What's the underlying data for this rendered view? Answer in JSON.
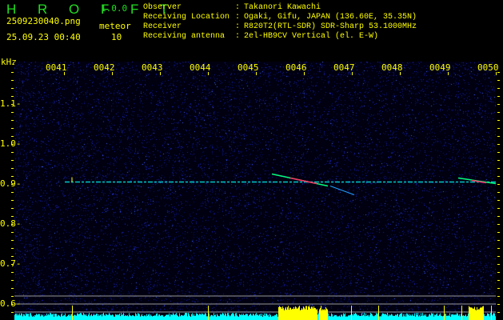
{
  "app": {
    "name": "H R O F F T",
    "version": "1.0.0"
  },
  "file": {
    "name": "2509230040.png",
    "datetime": "25.09.23 00:40"
  },
  "meteor": {
    "label": "meteor",
    "count": "10"
  },
  "info": [
    {
      "label": "Observer",
      "sep": ":",
      "value": "Takanori Kawachi"
    },
    {
      "label": "Receiving Location",
      "sep": ":",
      "value": "Ogaki, Gifu, JAPAN (136.60E, 35.35N)"
    },
    {
      "label": "Receiver",
      "sep": ":",
      "value": "R820T2(RTL-SDR) SDR-Sharp 53.1000MHz"
    },
    {
      "label": "Receiving antenna",
      "sep": ":",
      "value": "2el-HB9CV Vertical (el. E-W)"
    }
  ],
  "chart_data": {
    "type": "heatmap",
    "ylabel": "kHz",
    "x_ticks": [
      "0041",
      "0042",
      "0043",
      "0044",
      "0045",
      "0046",
      "0047",
      "0048",
      "0049",
      "0050"
    ],
    "y_ticks": [
      "1.1",
      "1.0",
      "0.9",
      "0.8",
      "0.7",
      "0.6"
    ],
    "ylim": [
      0.56,
      1.22
    ],
    "carrier_khz": 0.905,
    "colors": {
      "background": "#000010",
      "noise": "#2030ff",
      "text": "#ffff00",
      "histogram": "#00ffff",
      "histogram_detect": "#ffff00",
      "logo": "#22dd22"
    }
  }
}
